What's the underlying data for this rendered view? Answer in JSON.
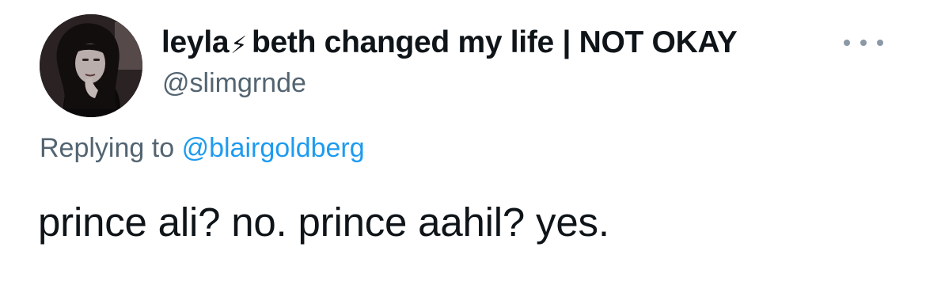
{
  "tweet": {
    "author": {
      "display_name_prefix": "leyla",
      "badge_glyph": "⚡",
      "display_name_suffix": "beth changed my life | NOT OKAY",
      "handle": "@slimgrnde",
      "avatar_icon": "profile-photo"
    },
    "more_icon": "more-options-icon",
    "replying_to": {
      "label": "Replying to",
      "mention": "@blairgoldberg"
    },
    "text": "prince ali? no. prince aahil? yes."
  },
  "colors": {
    "text_primary": "#0f1419",
    "text_secondary": "#536471",
    "link": "#1d9bf0",
    "more_dots": "#8b98a5"
  }
}
